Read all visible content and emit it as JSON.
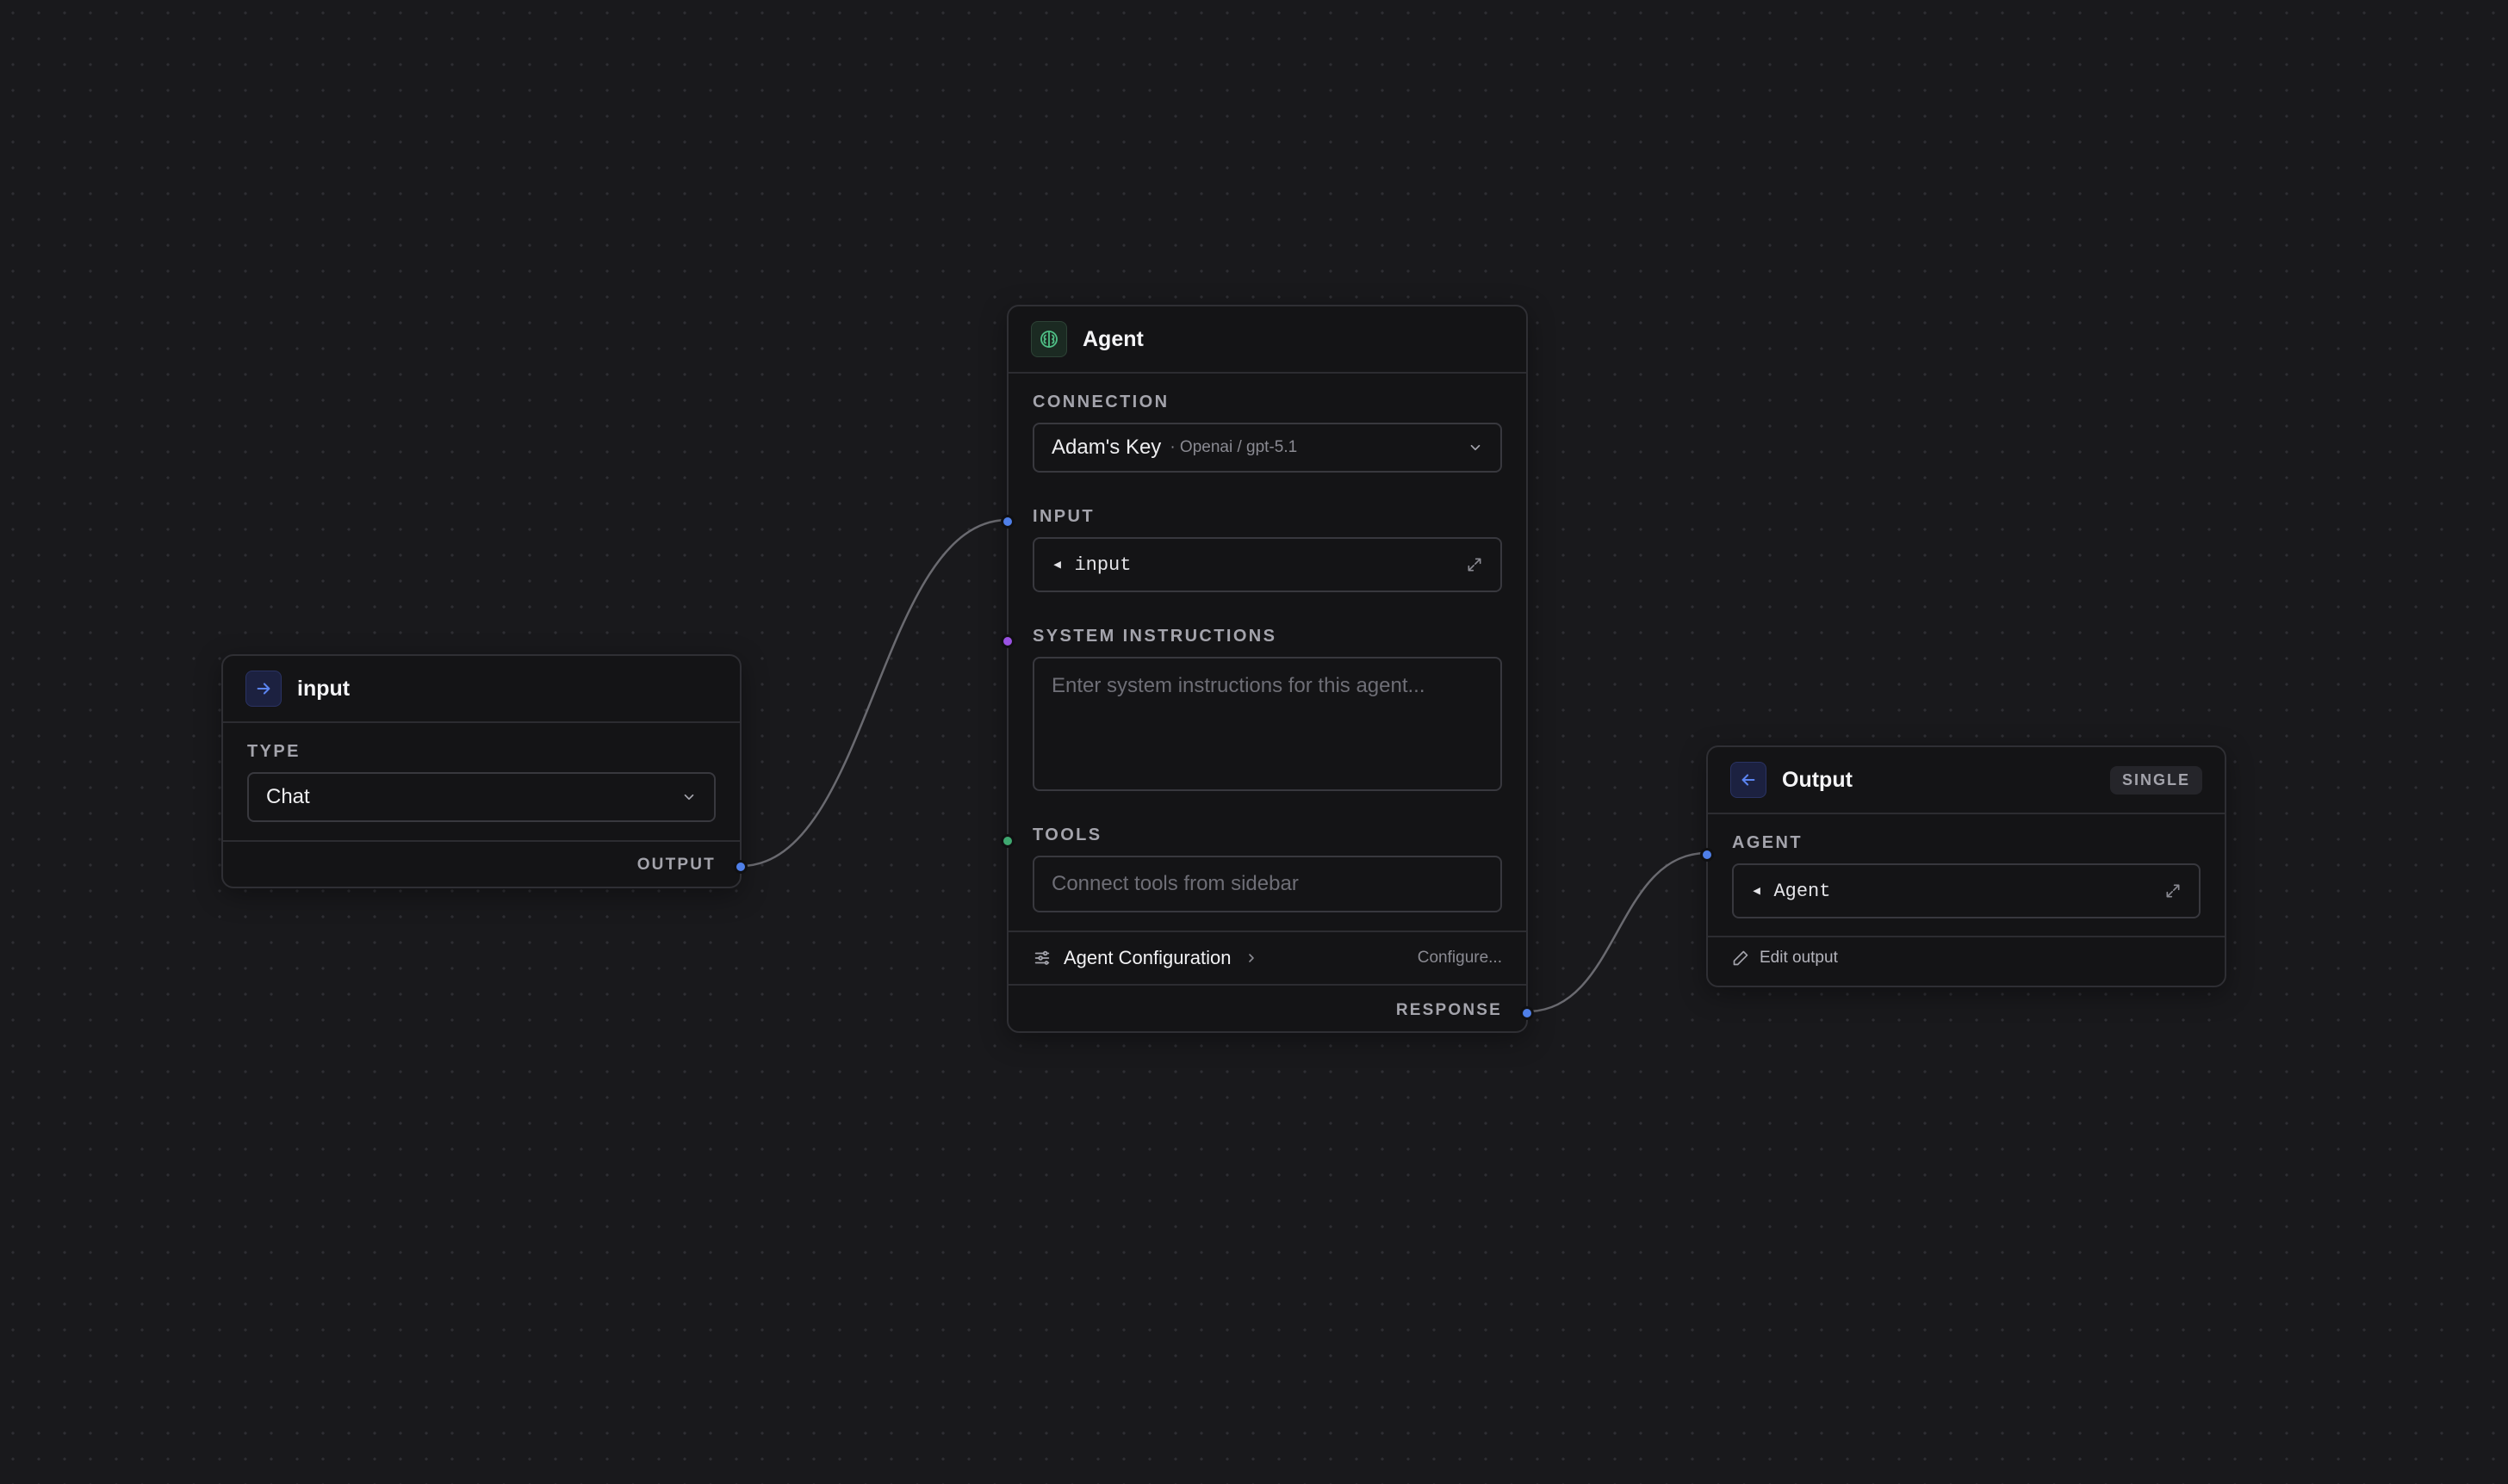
{
  "nodes": {
    "input": {
      "title": "input",
      "type_label": "TYPE",
      "type_value": "Chat",
      "output_label": "OUTPUT"
    },
    "agent": {
      "title": "Agent",
      "connection_label": "CONNECTION",
      "connection_value": "Adam's Key",
      "connection_detail": "· Openai / gpt-5.1",
      "input_label": "INPUT",
      "input_value": "◂ input",
      "system_label": "SYSTEM INSTRUCTIONS",
      "system_placeholder": "Enter system instructions for this agent...",
      "tools_label": "TOOLS",
      "tools_placeholder": "Connect tools from sidebar",
      "config_label": "Agent Configuration",
      "config_action": "Configure...",
      "response_label": "RESPONSE"
    },
    "output": {
      "title": "Output",
      "badge": "SINGLE",
      "agent_label": "AGENT",
      "agent_value": "◂ Agent",
      "edit_label": "Edit output"
    }
  },
  "colors": {
    "canvas": "#19191c",
    "node_bg": "#141416",
    "handle_blue": "#4f7fe8",
    "handle_purple": "#9a52e3",
    "handle_green": "#3fa870",
    "edge": "#6a6a70"
  },
  "icons": {
    "input_node": "arrow-right-icon",
    "agent_node": "brain-icon",
    "output_node": "arrow-left-icon"
  }
}
